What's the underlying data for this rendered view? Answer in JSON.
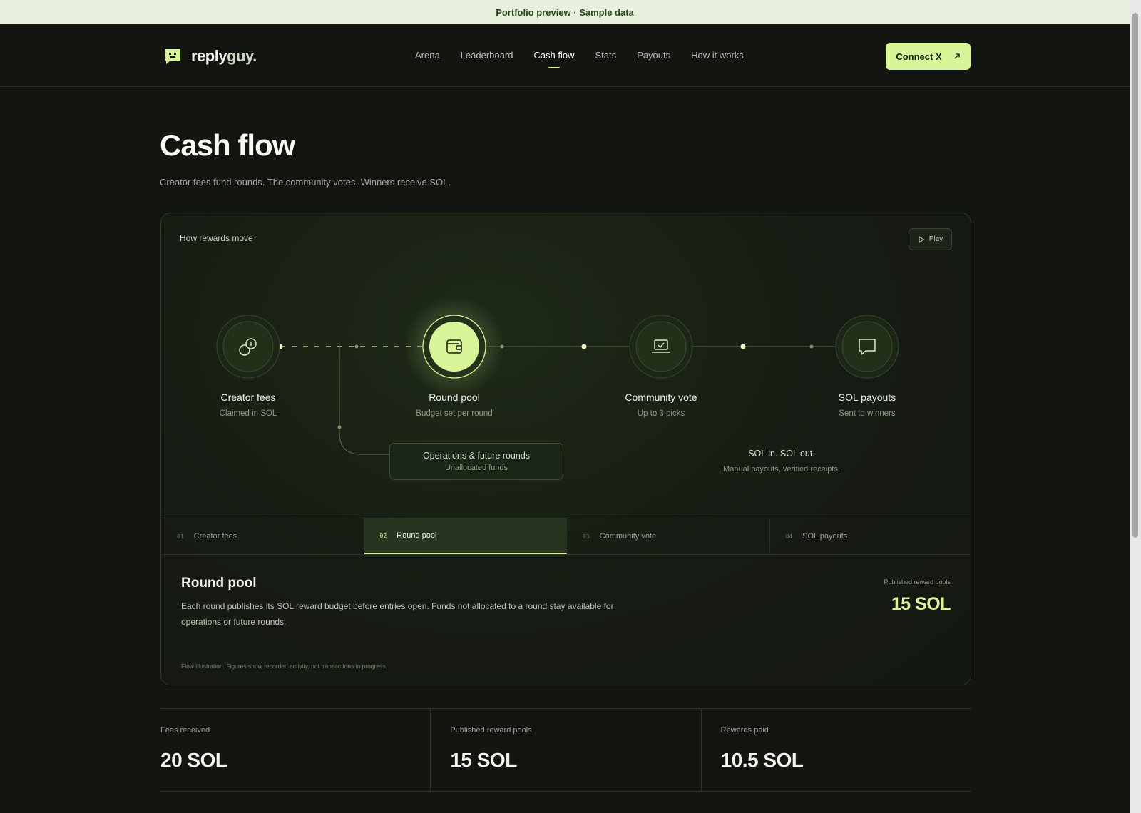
{
  "banner": {
    "text": "Portfolio preview · Sample data"
  },
  "brand": {
    "name_primary": "reply",
    "name_secondary": "guy."
  },
  "nav": {
    "items": [
      {
        "label": "Arena",
        "active": false
      },
      {
        "label": "Leaderboard",
        "active": false
      },
      {
        "label": "Cash flow",
        "active": true
      },
      {
        "label": "Stats",
        "active": false
      },
      {
        "label": "Payouts",
        "active": false
      },
      {
        "label": "How it works",
        "active": false
      }
    ],
    "connect_label": "Connect X"
  },
  "page": {
    "title": "Cash flow",
    "subtitle": "Creator fees fund rounds. The community votes. Winners receive SOL."
  },
  "flow": {
    "heading": "How rewards move",
    "play_label": "Play",
    "nodes": [
      {
        "label": "Creator fees",
        "sub": "Claimed in SOL",
        "icon": "coins-icon"
      },
      {
        "label": "Round pool",
        "sub": "Budget set per round",
        "icon": "wallet-icon"
      },
      {
        "label": "Community vote",
        "sub": "Up to 3 picks",
        "icon": "laptop-check-icon"
      },
      {
        "label": "SOL payouts",
        "sub": "Sent to winners",
        "icon": "message-icon"
      }
    ],
    "ops": {
      "title": "Operations & future rounds",
      "sub": "Unallocated funds"
    },
    "sol_note": {
      "title": "SOL in. SOL out.",
      "sub": "Manual payouts, verified receipts."
    }
  },
  "tabs": [
    {
      "num": "01",
      "label": "Creator fees",
      "active": false
    },
    {
      "num": "02",
      "label": "Round pool",
      "active": true
    },
    {
      "num": "03",
      "label": "Community vote",
      "active": false
    },
    {
      "num": "04",
      "label": "SOL payouts",
      "active": false
    }
  ],
  "detail": {
    "title": "Round pool",
    "text": "Each round publishes its SOL reward budget before entries open. Funds not allocated to a round stay available for operations or future rounds.",
    "stat_label": "Published reward pools",
    "stat_value": "15 SOL",
    "footnote": "Flow illustration. Figures show recorded activity, not transactions in progress."
  },
  "stats": [
    {
      "label": "Fees received",
      "value": "20 SOL"
    },
    {
      "label": "Published reward pools",
      "value": "15 SOL"
    },
    {
      "label": "Rewards paid",
      "value": "10.5 SOL"
    }
  ],
  "colors": {
    "accent": "#d8f59a",
    "background": "#121510",
    "banner": "#e6f0dd"
  }
}
